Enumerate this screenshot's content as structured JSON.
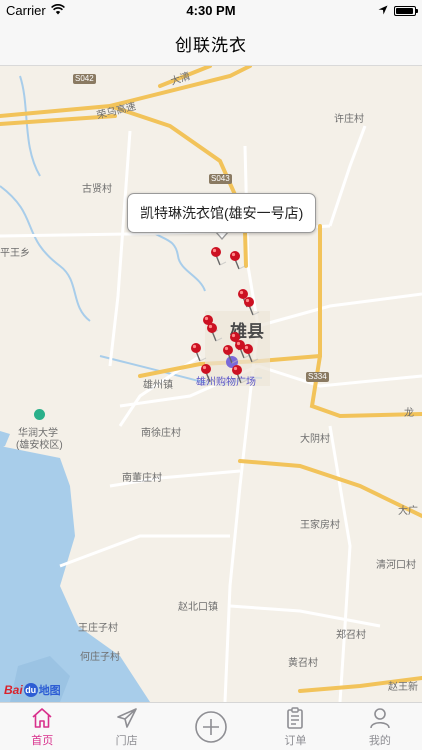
{
  "status_bar": {
    "carrier": "Carrier",
    "time": "4:30 PM",
    "battery_level": 0.95
  },
  "nav": {
    "title": "创联洗衣"
  },
  "map": {
    "callout_text": "凯特琳洗衣馆(雄安一号店)",
    "labels": {
      "rongwu_highway": "荣乌高速",
      "daqing": "大清",
      "xuzhuang": "许庄村",
      "guxian": "古贤村",
      "pingwang": "平王乡",
      "xiongxian": "雄县",
      "xiongzhou_town": "雄州镇",
      "xiongzhou_mall": "雄州购物广场",
      "huarun_university": "华润大学",
      "xiongan_campus": "(雄安校区)",
      "nanxuzhuang": "南徐庄村",
      "dayin": "大阴村",
      "long": "龙",
      "nandongzhuang": "南董庄村",
      "da_guang": "大广",
      "wangjiafang": "王家房村",
      "qinghekou": "清河口村",
      "zhaobeikou": "赵北口镇",
      "wangzhuangzi": "王庄子村",
      "zhengzhao": "郑召村",
      "hezhuangzi": "何庄子村",
      "huangzhao": "黄召村",
      "zhaowangxin": "赵王新"
    },
    "road_badges": {
      "s042": "S042",
      "s043": "S043",
      "s334": "S334"
    },
    "logo": {
      "part1": "Bai",
      "part2": "du",
      "part3": "地图"
    },
    "pin_count": 13
  },
  "tabs": [
    {
      "label": "首页",
      "icon": "home-icon",
      "active": true
    },
    {
      "label": "门店",
      "icon": "paper-plane-icon",
      "active": false
    },
    {
      "label": "",
      "icon": "plus-circle-icon",
      "active": false
    },
    {
      "label": "订单",
      "icon": "clipboard-icon",
      "active": false
    },
    {
      "label": "我的",
      "icon": "person-icon",
      "active": false
    }
  ],
  "colors": {
    "accent": "#d8308c",
    "tab_inactive": "#8e8e93",
    "pin": "#cc1122",
    "highway": "#f2c35a"
  }
}
